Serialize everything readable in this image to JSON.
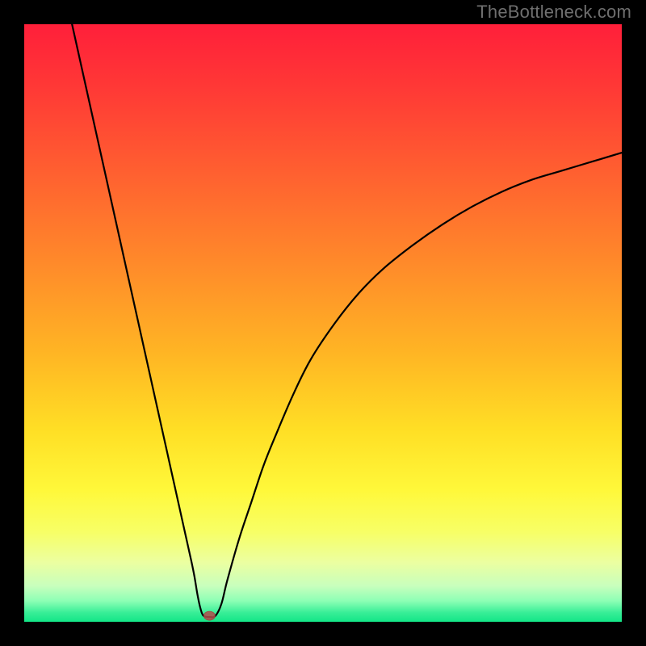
{
  "watermark": "TheBottleneck.com",
  "chart_data": {
    "type": "line",
    "title": "",
    "xlabel": "",
    "ylabel": "",
    "xlim": [
      0,
      100
    ],
    "ylim": [
      0,
      100
    ],
    "grid": false,
    "legend": false,
    "annotations": [
      {
        "type": "marker",
        "x": 31,
        "y": 1,
        "color": "#b14c4c",
        "shape": "ellipse"
      }
    ],
    "series": [
      {
        "name": "curve",
        "color": "#000000",
        "x": [
          8,
          10,
          12,
          14,
          16,
          18,
          20,
          22,
          24,
          26,
          27,
          28,
          28.5,
          29,
          29.5,
          30,
          31,
          32,
          33,
          34,
          36,
          38,
          40,
          42,
          45,
          48,
          52,
          56,
          60,
          65,
          70,
          75,
          80,
          85,
          90,
          95,
          100
        ],
        "y": [
          100,
          91,
          82,
          73,
          64,
          55,
          46,
          37,
          28,
          19,
          14.5,
          10,
          7.5,
          4.5,
          2.2,
          1.0,
          0.8,
          1.0,
          3,
          7,
          14,
          20,
          26,
          31,
          38,
          44,
          50,
          55,
          59,
          63,
          66.5,
          69.5,
          72,
          74,
          75.5,
          77,
          78.5
        ]
      }
    ],
    "background_gradient": {
      "type": "vertical",
      "stops": [
        {
          "offset": 0.0,
          "color": "#ff1f3a"
        },
        {
          "offset": 0.1,
          "color": "#ff3736"
        },
        {
          "offset": 0.25,
          "color": "#ff6030"
        },
        {
          "offset": 0.4,
          "color": "#ff8a2a"
        },
        {
          "offset": 0.55,
          "color": "#ffb524"
        },
        {
          "offset": 0.68,
          "color": "#ffdf25"
        },
        {
          "offset": 0.78,
          "color": "#fff83a"
        },
        {
          "offset": 0.85,
          "color": "#f7ff66"
        },
        {
          "offset": 0.9,
          "color": "#ecffa0"
        },
        {
          "offset": 0.94,
          "color": "#c8ffbd"
        },
        {
          "offset": 0.965,
          "color": "#8dffb5"
        },
        {
          "offset": 0.985,
          "color": "#37ee97"
        },
        {
          "offset": 1.0,
          "color": "#13e687"
        }
      ]
    }
  }
}
